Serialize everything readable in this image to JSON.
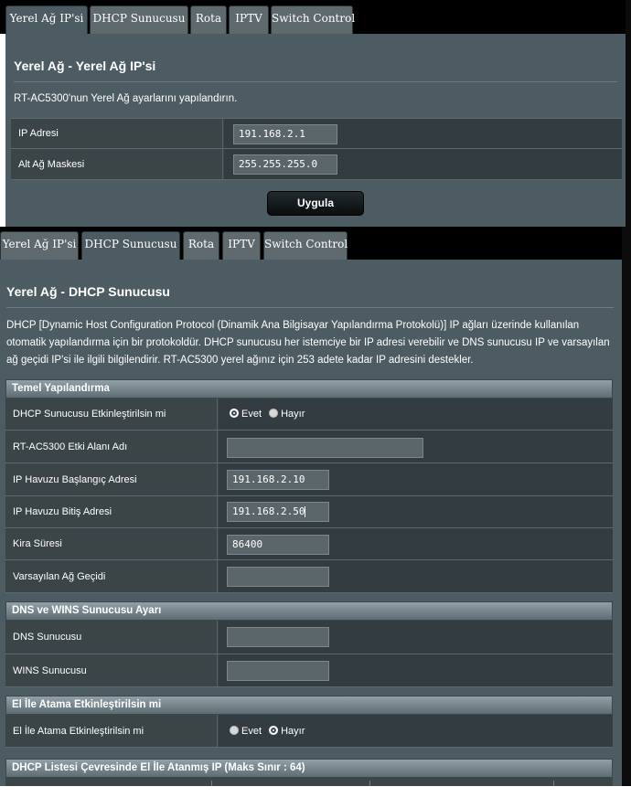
{
  "tabs": [
    "Yerel Ağ IP'si",
    "DHCP Sunucusu",
    "Rota",
    "IPTV",
    "Switch Control"
  ],
  "lan": {
    "title": "Yerel Ağ - Yerel Ağ IP'si",
    "description": "RT-AC5300'nun Yerel Ağ ayarlarını yapılandırın.",
    "ip_label": "IP Adresi",
    "ip_value": "191.168.2.1",
    "mask_label": "Alt Ağ Maskesi",
    "mask_value": "255.255.255.0",
    "apply": "Uygula"
  },
  "dhcp": {
    "title": "Yerel Ağ - DHCP Sunucusu",
    "desc_lines": [
      "DHCP [Dynamic Host Configuration Protocol (Dinamik Ana Bilgisayar Yapılandırma Protokolü)] IP ağları üzerinde kullanılan",
      "otomatik yapılandırma için bir protokoldür. DHCP sunucusu her istemciye bir IP adresi verebilir ve DNS sunucusu IP ve varsayılan",
      "ağ geçidi IP'si ile ilgili bilgilendirir. RT-AC5300 yerel ağınız için 253 adete kadar IP adresini destekler."
    ],
    "basic_header": "Temel Yapılandırma",
    "enable_label": "DHCP Sunucusu Etkinleştirilsin mi",
    "yes": "Evet",
    "no": "Hayır",
    "domain_label": "RT-AC5300 Etki Alanı Adı",
    "domain_value": "",
    "start_label": "IP Havuzu Başlangıç Adresi",
    "start_value": "191.168.2.10",
    "end_label": "IP Havuzu Bitiş Adresi",
    "end_value": "191.168.2.50",
    "lease_label": "Kira Süresi",
    "lease_value": "86400",
    "gateway_label": "Varsayılan Ağ Geçidi",
    "gateway_value": "",
    "dns_header": "DNS ve WINS Sunucusu Ayarı",
    "dns_label": "DNS Sunucusu",
    "dns_value": "",
    "wins_label": "WINS Sunucusu",
    "wins_value": "",
    "manual_header": "El İle Atama Etkinleştirilsin mi",
    "manual_label": "El İle Atama Etkinleştirilsin mi",
    "list_header": "DHCP Listesi Çevresinde El İle Atanmış IP (Maks Sınır : 64)"
  }
}
